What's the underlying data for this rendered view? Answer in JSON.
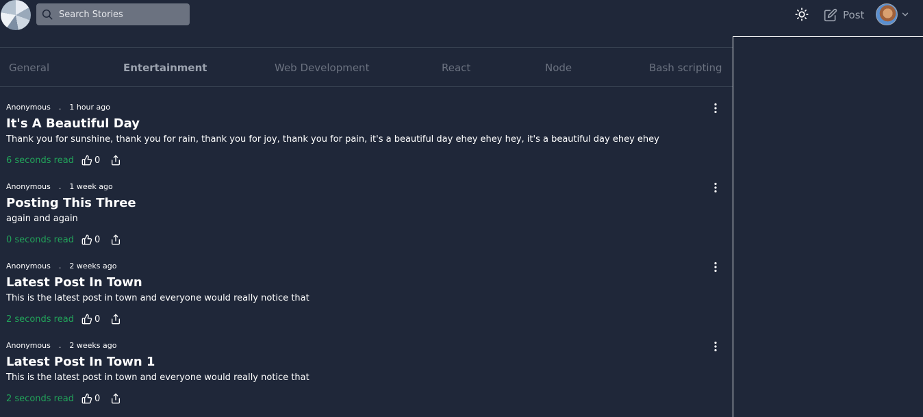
{
  "header": {
    "search_placeholder": "Search Stories",
    "post_label": "Post"
  },
  "tabs": [
    {
      "label": "General",
      "active": false
    },
    {
      "label": "Entertainment",
      "active": true
    },
    {
      "label": "Web Development",
      "active": false
    },
    {
      "label": "React",
      "active": false
    },
    {
      "label": "Node",
      "active": false
    },
    {
      "label": "Bash scripting",
      "active": false
    }
  ],
  "stories": [
    {
      "author": "Anonymous",
      "separator": ".",
      "time": "1 hour ago",
      "title": "It's A Beautiful Day",
      "excerpt": "Thank you for sunshine, thank you for rain, thank you for joy, thank you for pain, it's a beautiful day ehey ehey hey, it's a beautiful day ehey ehey",
      "read_time": "6 seconds read",
      "likes": "0"
    },
    {
      "author": "Anonymous",
      "separator": ".",
      "time": "1 week ago",
      "title": "Posting This Three",
      "excerpt": "again and again",
      "read_time": "0 seconds read",
      "likes": "0"
    },
    {
      "author": "Anonymous",
      "separator": ".",
      "time": "2 weeks ago",
      "title": "Latest Post In Town",
      "excerpt": "This is the latest post in town and everyone would really notice that",
      "read_time": "2 seconds read",
      "likes": "0"
    },
    {
      "author": "Anonymous",
      "separator": ".",
      "time": "2 weeks ago",
      "title": "Latest Post In Town 1",
      "excerpt": "This is the latest post in town and everyone would really notice that",
      "read_time": "2 seconds read",
      "likes": "0"
    }
  ],
  "colors": {
    "background": "#1f2739",
    "read_time": "#22a35a",
    "tab_inactive": "#6b7280",
    "tab_active": "#9ca3af"
  },
  "icons": {
    "search": "search-icon",
    "theme": "sun-icon",
    "post": "edit-icon",
    "chevron": "chevron-down-icon",
    "like": "thumbs-up-icon",
    "share": "share-icon",
    "menu": "more-vertical-icon"
  }
}
